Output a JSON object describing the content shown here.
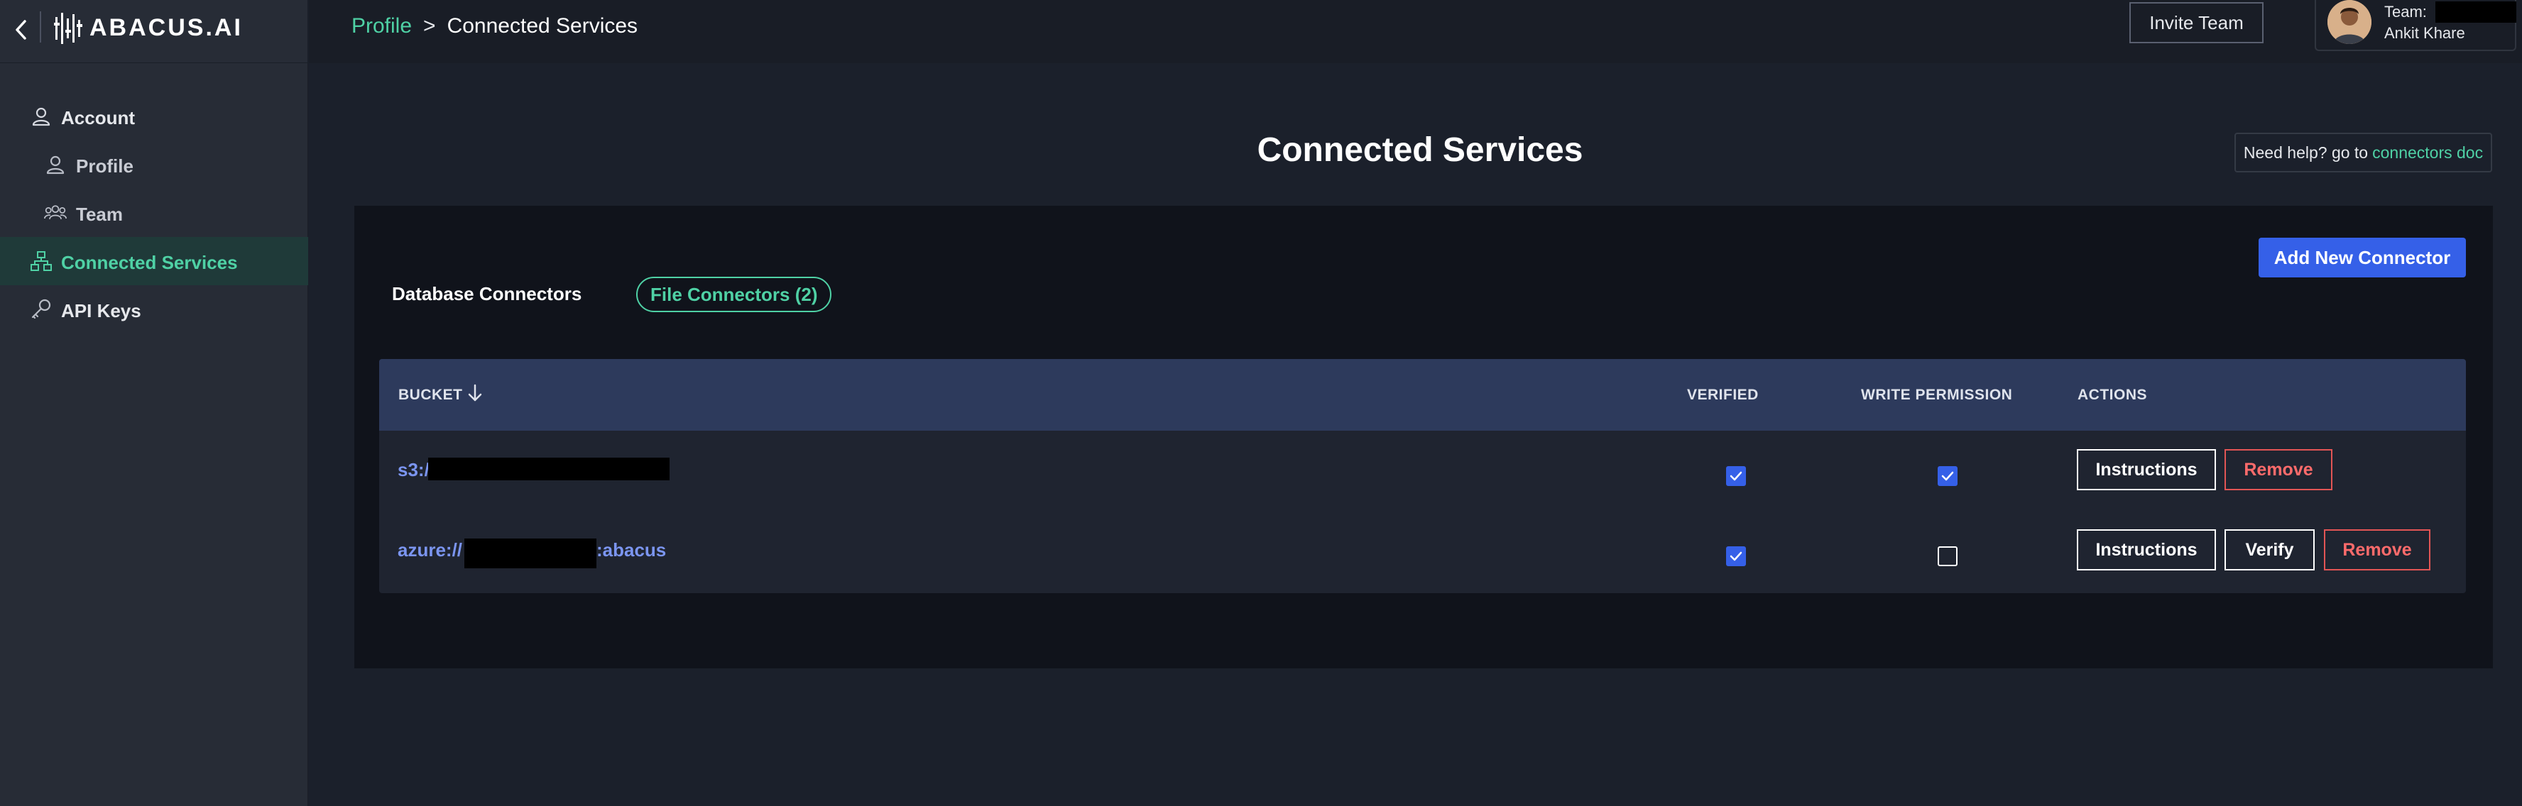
{
  "brand": {
    "name": "ABACUS.AI"
  },
  "breadcrumb": {
    "parent": "Profile",
    "separator": ">",
    "current": "Connected Services"
  },
  "header": {
    "invite_label": "Invite Team",
    "team_label": "Team:",
    "user_name": "Ankit Khare"
  },
  "sidebar": {
    "items": [
      {
        "label": "Account",
        "icon": "user-icon"
      },
      {
        "label": "Profile",
        "icon": "user-icon"
      },
      {
        "label": "Team",
        "icon": "team-icon"
      },
      {
        "label": "Connected Services",
        "icon": "network-icon",
        "active": true
      },
      {
        "label": "API Keys",
        "icon": "key-icon"
      }
    ]
  },
  "main": {
    "title": "Connected Services",
    "help_prefix": "Need help? go to",
    "help_link": "connectors doc",
    "tabs": [
      {
        "label": "Database Connectors"
      },
      {
        "label": "File Connectors (2)",
        "active": true
      }
    ],
    "add_button": "Add New Connector",
    "table": {
      "columns": [
        "BUCKET",
        "VERIFIED",
        "WRITE PERMISSION",
        "ACTIONS"
      ],
      "rows": [
        {
          "bucket_prefix": "s3:/",
          "bucket_suffix": "",
          "verified": true,
          "write_permission": true,
          "actions": [
            "Instructions",
            "Remove"
          ]
        },
        {
          "bucket_prefix": "azure://",
          "bucket_suffix": ":abacus",
          "verified": true,
          "write_permission": false,
          "actions": [
            "Instructions",
            "Verify",
            "Remove"
          ]
        }
      ]
    }
  },
  "colors": {
    "accent": "#4fd1a5",
    "primary_button": "#3560e8",
    "danger": "#e25555",
    "link": "#7b95f0"
  }
}
